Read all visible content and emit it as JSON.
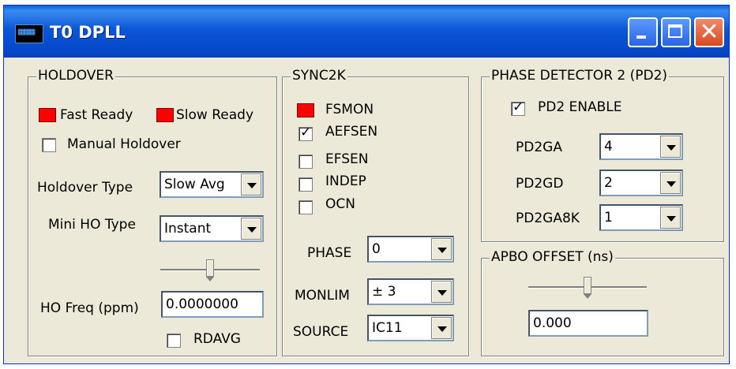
{
  "window": {
    "title": "T0 DPLL",
    "icon": "app-icon"
  },
  "holdover": {
    "title": "HOLDOVER",
    "fast_ready": "Fast Ready",
    "slow_ready": "Slow Ready",
    "manual_holdover": {
      "label": "Manual Holdover",
      "checked": false
    },
    "holdover_type": {
      "label": "Holdover Type",
      "value": "Slow Avg"
    },
    "mini_ho_type": {
      "label": "Mini HO Type",
      "value": "Instant"
    },
    "ho_freq": {
      "label": "HO Freq (ppm)",
      "value": "0.0000000"
    },
    "rdavg": {
      "label": "RDAVG",
      "checked": false
    }
  },
  "sync2k": {
    "title": "SYNC2K",
    "fsmon": "FSMON",
    "aefsen": {
      "label": "AEFSEN",
      "checked": true
    },
    "efsen": {
      "label": "EFSEN",
      "checked": false
    },
    "indep": {
      "label": "INDEP",
      "checked": false
    },
    "ocn": {
      "label": "OCN",
      "checked": false
    },
    "phase": {
      "label": "PHASE",
      "value": "0"
    },
    "monlim": {
      "label": "MONLIM",
      "value": "± 3"
    },
    "source": {
      "label": "SOURCE",
      "value": "IC11"
    }
  },
  "pd2": {
    "title": "PHASE DETECTOR 2 (PD2)",
    "enable": {
      "label": "PD2 ENABLE",
      "checked": true
    },
    "pd2ga": {
      "label": "PD2GA",
      "value": "4"
    },
    "pd2gd": {
      "label": "PD2GD",
      "value": "2"
    },
    "pd2ga8k": {
      "label": "PD2GA8K",
      "value": "1"
    }
  },
  "apbo": {
    "title": "APBO OFFSET (ns)",
    "value": "0.000"
  },
  "colors": {
    "indicator_red": "#ff0000",
    "titlebar_blue": "#0b56d8",
    "face": "#ece9d8"
  }
}
